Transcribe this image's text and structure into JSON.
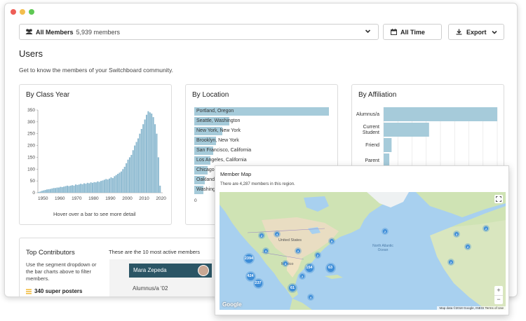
{
  "segment": {
    "label": "All Members",
    "count": "5,939 members"
  },
  "toolbar": {
    "time_label": "All Time",
    "export_label": "Export"
  },
  "page": {
    "title": "Users",
    "description": "Get to know the members of your Switchboard community."
  },
  "class_year": {
    "title": "By Class Year",
    "hint": "Hover over a bar to see more detail",
    "y_ticks": [
      "350",
      "300",
      "250",
      "200",
      "150",
      "100",
      "50",
      "0"
    ],
    "x_ticks": [
      "1950",
      "1960",
      "1970",
      "1980",
      "1990",
      "2000",
      "2010",
      "2020"
    ]
  },
  "chart_data": {
    "type": "bar",
    "title": "By Class Year",
    "xlabel": "",
    "ylabel": "",
    "xlim": [
      1947,
      2020
    ],
    "ylim": [
      0,
      350
    ],
    "x": [
      1947,
      1948,
      1949,
      1950,
      1951,
      1952,
      1953,
      1954,
      1955,
      1956,
      1957,
      1958,
      1959,
      1960,
      1961,
      1962,
      1963,
      1964,
      1965,
      1966,
      1967,
      1968,
      1969,
      1970,
      1971,
      1972,
      1973,
      1974,
      1975,
      1976,
      1977,
      1978,
      1979,
      1980,
      1981,
      1982,
      1983,
      1984,
      1985,
      1986,
      1987,
      1988,
      1989,
      1990,
      1991,
      1992,
      1993,
      1994,
      1995,
      1996,
      1997,
      1998,
      1999,
      2000,
      2001,
      2002,
      2003,
      2004,
      2005,
      2006,
      2007,
      2008,
      2009,
      2010,
      2011,
      2012,
      2013,
      2014,
      2015,
      2016,
      2017,
      2018,
      2019
    ],
    "values": [
      3,
      5,
      8,
      10,
      12,
      14,
      15,
      16,
      18,
      20,
      20,
      22,
      22,
      25,
      24,
      26,
      28,
      30,
      28,
      30,
      32,
      30,
      35,
      33,
      35,
      38,
      36,
      40,
      38,
      42,
      40,
      44,
      42,
      45,
      44,
      48,
      46,
      50,
      52,
      55,
      58,
      56,
      60,
      65,
      62,
      70,
      75,
      80,
      85,
      90,
      100,
      110,
      125,
      140,
      150,
      160,
      180,
      200,
      215,
      230,
      250,
      270,
      290,
      310,
      330,
      345,
      340,
      335,
      320,
      290,
      250,
      150,
      30
    ],
    "grid": false,
    "legend": "none"
  },
  "location": {
    "title": "By Location",
    "items": [
      {
        "label": "Portland, Oregon",
        "value": 1.0
      },
      {
        "label": "Seattle, Washington",
        "value": 0.26
      },
      {
        "label": "New York, New York",
        "value": 0.21
      },
      {
        "label": "Brooklyn, New York",
        "value": 0.16
      },
      {
        "label": "San Francisco, California",
        "value": 0.14
      },
      {
        "label": "Los Angeles, California",
        "value": 0.12
      },
      {
        "label": "Chicago, Illinois",
        "value": 0.1
      },
      {
        "label": "Oakland, California",
        "value": 0.08
      },
      {
        "label": "Washington, D.C.",
        "value": 0.07
      }
    ],
    "axis_start": "0"
  },
  "affiliation": {
    "title": "By Affiliation",
    "items": [
      {
        "label": "Alumnus/a",
        "value": 1.0
      },
      {
        "label": "Current Student",
        "value": 0.4
      },
      {
        "label": "Friend",
        "value": 0.07
      },
      {
        "label": "Parent",
        "value": 0.05
      }
    ]
  },
  "contributors": {
    "title": "Top Contributors",
    "description": "Use the segment dropdown or the bar charts above to filter members.",
    "super_posters": "340 super posters",
    "intro": "These are the 10 most active members",
    "top_name": "Mara Zepeda",
    "top_affiliation": "Alumnus/a '02"
  },
  "member_map": {
    "title": "Member Map",
    "subtitle": "There are 4,287 members in this region.",
    "clusters": [
      "2394",
      "424",
      "237",
      "154",
      "63",
      "61",
      "2",
      "4",
      "3",
      "2",
      "2",
      "5",
      "3",
      "2",
      "4",
      "2",
      "3",
      "2",
      "2",
      "2"
    ],
    "labels": {
      "united_states": "United States",
      "mexico": "Mexico",
      "north_atlantic": "North Atlantic Ocean",
      "zoom_in": "+",
      "zoom_out": "−",
      "google": "Google",
      "attribution": "Map data ©2018 Google, INEGI  Terms of Use"
    }
  },
  "colors": {
    "bar_blue": "#8fbbd1",
    "bar_light": "#a6cbda",
    "accent_dark": "#2b5565",
    "cluster_blue": "#3d8dd8",
    "star_yellow": "#f0b429"
  }
}
